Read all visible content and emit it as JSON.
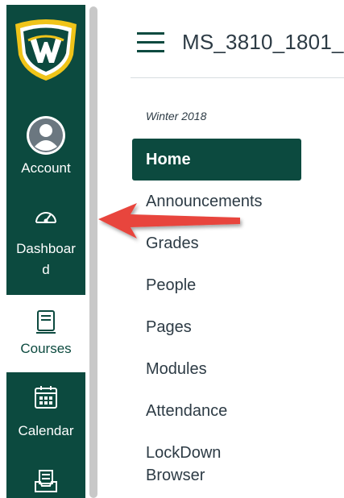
{
  "global_nav": {
    "items": [
      {
        "label": "Account",
        "icon": "account-icon"
      },
      {
        "label": "Dashboar",
        "label2": "d",
        "icon": "dashboard-icon"
      },
      {
        "label": "Courses",
        "icon": "courses-icon"
      },
      {
        "label": "Calendar",
        "icon": "calendar-icon"
      },
      {
        "icon": "inbox-icon"
      }
    ]
  },
  "header": {
    "course_title": "MS_3810_1801_"
  },
  "course_nav": {
    "term": "Winter 2018",
    "items": [
      {
        "label": "Home"
      },
      {
        "label": "Announcements"
      },
      {
        "label": "Grades"
      },
      {
        "label": "People"
      },
      {
        "label": "Pages"
      },
      {
        "label": "Modules"
      },
      {
        "label": "Attendance"
      },
      {
        "label": "LockDown",
        "label2": "Browser"
      }
    ]
  },
  "colors": {
    "brand": "#0c4a3f",
    "logo_gold": "#f0c419",
    "arrow": "#e8453c",
    "text": "#2d3b45"
  }
}
